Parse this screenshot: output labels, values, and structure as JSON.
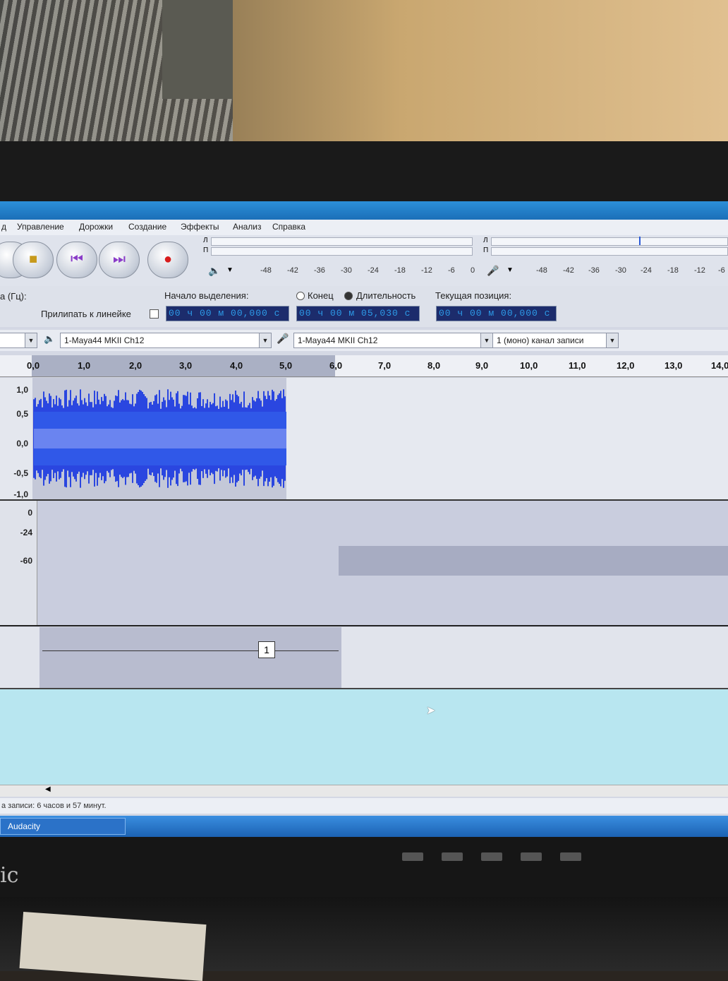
{
  "app": {
    "taskbar_item": "Audacity"
  },
  "menu": [
    "д",
    "Управление",
    "Дорожки",
    "Создание",
    "Эффекты",
    "Анализ",
    "Справка"
  ],
  "transport": {
    "stop_icon": "stop-icon",
    "rewind_icon": "skip-start-icon",
    "forward_icon": "skip-end-icon",
    "record_icon": "record-icon"
  },
  "meters": {
    "play_ticks": [
      "-48",
      "-42",
      "-36",
      "-30",
      "-24",
      "-18",
      "-12",
      "-6",
      "0"
    ],
    "rec_ticks": [
      "-48",
      "-42",
      "-36",
      "-30",
      "-24",
      "-18",
      "-12",
      "-6"
    ],
    "channel_l": "Л",
    "channel_r": "П"
  },
  "selection": {
    "rate_label": "а (Гц):",
    "snap_label": "Прилипать к линейке",
    "start_label": "Начало выделения:",
    "end_label": "Конец",
    "length_label": "Длительность",
    "position_label": "Текущая позиция:",
    "start_value": "00 ч 00 м 00,000 с",
    "length_value": "00 ч 00 м 05,030 с",
    "position_value": "00 ч 00 м 00,000 с"
  },
  "devices": {
    "playback_device": "1-Maya44 MKII Ch12",
    "record_device": "1-Maya44 MKII Ch12",
    "channels": "1 (моно) канал записи"
  },
  "ruler": {
    "labels": [
      "0,0",
      "1,0",
      "2,0",
      "3,0",
      "4,0",
      "5,0",
      "6,0",
      "7,0",
      "8,0",
      "9,0",
      "10,0",
      "11,0",
      "12,0",
      "13,0",
      "14,0"
    ]
  },
  "track1": {
    "y_labels": [
      "1,0",
      "0,5",
      "0,0",
      "-0,5",
      "-1,0"
    ],
    "wave_color": "#2a46e0"
  },
  "track2": {
    "y_labels": [
      "0",
      "-24",
      "-60"
    ]
  },
  "track3": {
    "label_text": "1"
  },
  "status": {
    "text": "а записи: 6 часов и 57 минут."
  }
}
